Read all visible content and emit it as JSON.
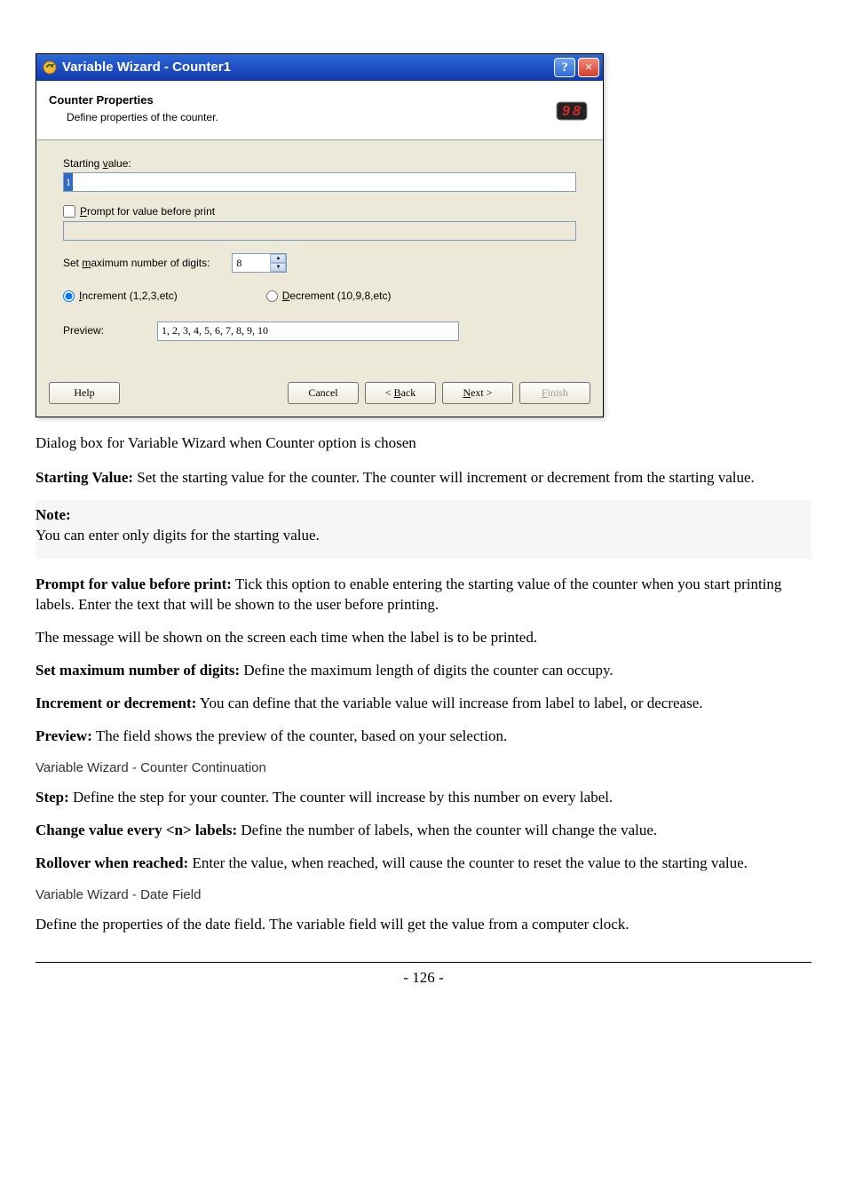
{
  "dialog": {
    "title": "Variable Wizard - Counter1",
    "header_title": "Counter Properties",
    "header_sub": "Define properties of the counter.",
    "starting_value_label_pre": "Starting ",
    "starting_value_label_u": "v",
    "starting_value_label_post": "alue:",
    "starting_value": "1",
    "prompt_label_u": "P",
    "prompt_label_post": "rompt for value before print",
    "prompt_input": "",
    "max_digits_label_pre": "Set ",
    "max_digits_label_u": "m",
    "max_digits_label_post": "aximum number of digits:",
    "max_digits_value": "8",
    "increment_u": "I",
    "increment_post": "ncrement  (1,2,3,etc)",
    "decrement_u": "D",
    "decrement_post": "ecrement  (10,9,8,etc)",
    "preview_label": "Preview:",
    "preview_value": "1, 2, 3, 4, 5, 6, 7, 8, 9, 10",
    "btn_help": "Help",
    "btn_cancel": "Cancel",
    "btn_back_pre": "< ",
    "btn_back_u": "B",
    "btn_back_post": "ack",
    "btn_next_u": "N",
    "btn_next_post": "ext >",
    "btn_finish_u": "F",
    "btn_finish_post": "inish"
  },
  "caption": "Dialog box for Variable Wizard when Counter option is chosen",
  "p_starting_b": "Starting Value:",
  "p_starting": " Set the starting value for the counter. The counter will increment or decrement from the starting value.",
  "note_b": "Note:",
  "note_body": " You can enter only digits for the starting value.",
  "p_prompt_b": "Prompt for value before print:",
  "p_prompt": " Tick this option to enable entering the starting value of the counter when you start printing labels. Enter the text that will be shown to the user before printing.",
  "p_msg": "The message will be shown on the screen each time when the label is to be printed.",
  "p_max_b": "Set maximum number of digits:",
  "p_max": " Define the maximum length of digits the counter can occupy.",
  "p_inc_b": "Increment or decrement:",
  "p_inc": " You can define that the variable value will increase from label to label, or decrease.",
  "p_prev_b": "Preview:",
  "p_prev": " The field shows the preview of the counter, based on your selection.",
  "sub1": "Variable Wizard - Counter Continuation",
  "p_step_b": "Step:",
  "p_step": " Define the step for your counter. The counter will increase by this number on every label.",
  "p_change_b": "Change value every <n> labels:",
  "p_change": " Define the number of labels, when the counter will change the value.",
  "p_roll_b": "Rollover when reached:",
  "p_roll": " Enter the value, when reached, will cause the counter to reset the value to the starting value.",
  "sub2": "Variable Wizard - Date Field",
  "p_date": "Define the properties of the date field. The variable field will get the value from a computer clock.",
  "page_num": "- 126 -"
}
